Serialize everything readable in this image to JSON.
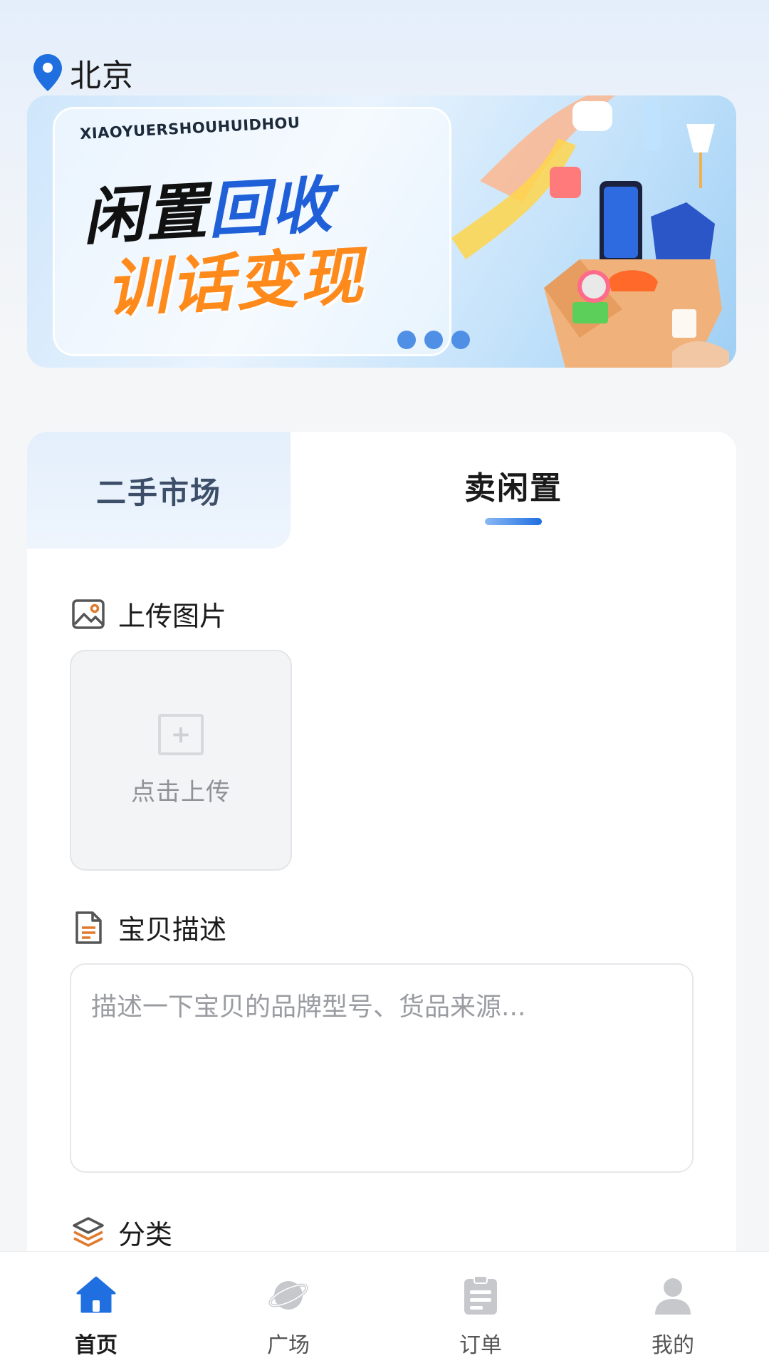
{
  "location": {
    "city": "北京"
  },
  "banner": {
    "subtitle": "XIAOYUERSHOUHUIDHOU",
    "headline_black": "闲置",
    "headline_blue": "回收",
    "headline_orange": "训话变现",
    "page_dots": 3
  },
  "tabs": [
    {
      "label": "二手市场",
      "active": false
    },
    {
      "label": "卖闲置",
      "active": true
    }
  ],
  "form": {
    "upload_title": "上传图片",
    "upload_button": "点击上传",
    "description_title": "宝贝描述",
    "description_placeholder": "描述一下宝贝的品牌型号、货品来源...",
    "category_title": "分类"
  },
  "bottom_nav": [
    {
      "label": "首页",
      "icon": "home-icon",
      "active": true
    },
    {
      "label": "广场",
      "icon": "planet-icon",
      "active": false
    },
    {
      "label": "订单",
      "icon": "clipboard-icon",
      "active": false
    },
    {
      "label": "我的",
      "icon": "user-icon",
      "active": false
    }
  ],
  "colors": {
    "accent_blue": "#1f6fe0",
    "headline_orange": "#ff8a1c",
    "section_icon_orange": "#e07a2c",
    "inactive_icon": "#c6c8cc"
  }
}
